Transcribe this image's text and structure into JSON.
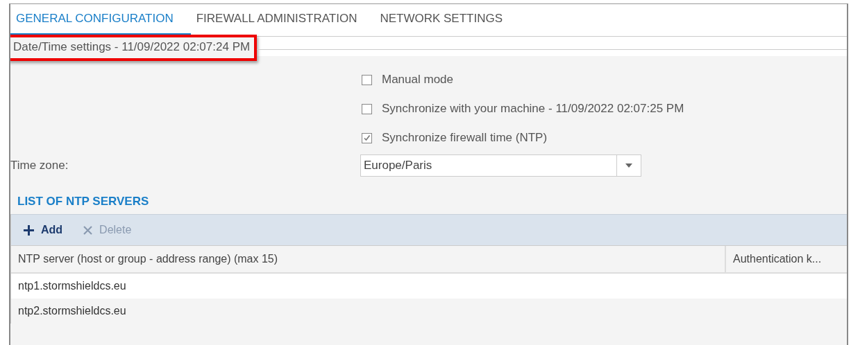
{
  "tabs": [
    {
      "label": "GENERAL CONFIGURATION",
      "selected": true
    },
    {
      "label": "FIREWALL ADMINISTRATION",
      "selected": false
    },
    {
      "label": "NETWORK SETTINGS",
      "selected": false
    }
  ],
  "section": {
    "title": "Date/Time settings - 11/09/2022 02:07:24 PM",
    "highlighted": true
  },
  "options": [
    {
      "label": "Manual mode",
      "checked": false
    },
    {
      "label": "Synchronize with your machine - 11/09/2022 02:07:25 PM",
      "checked": false
    },
    {
      "label": "Synchronize firewall time (NTP)",
      "checked": true
    }
  ],
  "time_zone": {
    "label": "Time zone:",
    "value": "Europe/Paris"
  },
  "ntp_list": {
    "title": "LIST OF NTP SERVERS",
    "toolbar": [
      {
        "kind": "add",
        "label": "Add",
        "disabled": false
      },
      {
        "kind": "delete",
        "label": "Delete",
        "disabled": true
      }
    ],
    "columns": [
      "NTP server (host or group - address range) (max 15)",
      "Authentication k..."
    ],
    "rows": [
      [
        "ntp1.stormshieldcs.eu"
      ],
      [
        "ntp2.stormshieldcs.eu"
      ]
    ]
  }
}
